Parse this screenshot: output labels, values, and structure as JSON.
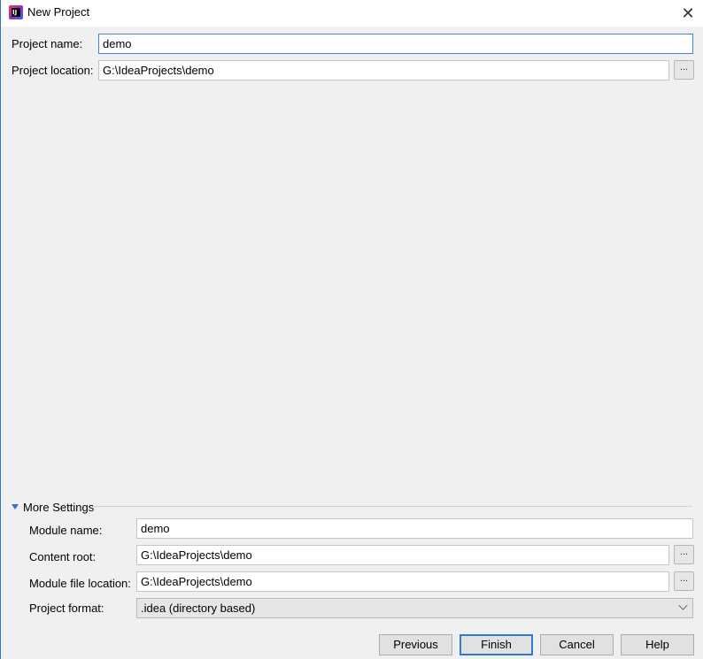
{
  "window": {
    "title": "New Project",
    "icon": "intellij-idea-icon",
    "accent": "#3d86d8"
  },
  "project": {
    "name_label": "Project name:",
    "name_value": "demo",
    "location_label": "Project location:",
    "location_value": "G:\\IdeaProjects\\demo",
    "browse_label": "..."
  },
  "more_settings": {
    "toggle_label": "More Settings",
    "expanded": true,
    "module_name_label": "Module name:",
    "module_name_value": "demo",
    "content_root_label": "Content root:",
    "content_root_value": "G:\\IdeaProjects\\demo",
    "module_file_label": "Module file location:",
    "module_file_value": "G:\\IdeaProjects\\demo",
    "format_label": "Project format:",
    "format_value": ".idea (directory based)",
    "browse_label": "..."
  },
  "buttons": {
    "previous": "Previous",
    "finish": "Finish",
    "cancel": "Cancel",
    "help": "Help"
  }
}
